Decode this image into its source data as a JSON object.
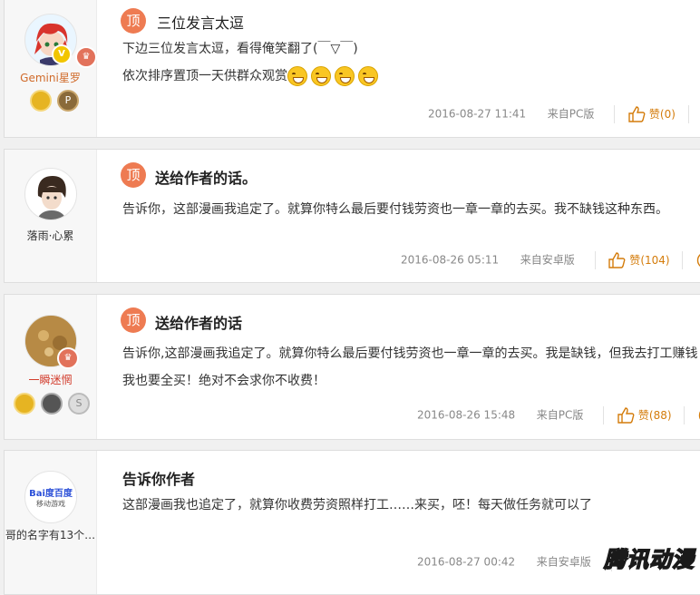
{
  "posts": [
    {
      "username": "Gemini星罗",
      "username_color": "#d06a2a",
      "pinned_label": "顶",
      "title": "三位发言太逗",
      "content_lines": [
        "下边三位发言太逗，看得俺笑翻了(￣▽￣)",
        "依次排序置顶一天供群众观赏"
      ],
      "date": "2016-08-27 11:41",
      "source": "来自PC版",
      "like_label": "赞",
      "like_count": "(0)",
      "vip_badge": "V",
      "emoji_count": 4
    },
    {
      "username": "落雨·心累",
      "username_color": "#333333",
      "pinned_label": "顶",
      "title": "送给作者的话。",
      "content_lines": [
        "告诉你，这部漫画我追定了。就算你特么最后要付钱劳资也一章一章的去买。我不缺钱这种东西。"
      ],
      "date": "2016-08-26 05:11",
      "source": "来自安卓版",
      "like_label": "赞",
      "like_count": "(104)"
    },
    {
      "username": "一瞬迷惘",
      "username_color": "#d23a2a",
      "pinned_label": "顶",
      "title": "送给作者的话",
      "content_lines": [
        "告诉你,这部漫画我追定了。就算你特么最后要付钱劳资也一章一章的去买。我是缺钱，但我去打工赚钱",
        "我也要全买！绝对不会求你不收费！"
      ],
      "date": "2016-08-26 15:48",
      "source": "来自PC版",
      "like_label": "赞",
      "like_count": "(88)"
    },
    {
      "username": "哥的名字有13个…",
      "username_color": "#333333",
      "title": "告诉你作者",
      "content_lines": [
        "这部漫画我也追定了，就算你收费劳资照样打工……来买，呸！每天做任务就可以了"
      ],
      "date": "2016-08-27 00:42",
      "source": "来自安卓版",
      "avatar_text": "Bai度百度",
      "avatar_subtext": "移动游戏"
    }
  ],
  "watermark": "腾讯动漫",
  "colors": {
    "pinned": "#ee7b52",
    "like": "#d47c0b",
    "meta": "#888888"
  },
  "icons": [
    "vip-badge-icon",
    "crown-icon",
    "medal-icon",
    "thumbs-up-icon",
    "comment-icon",
    "smiley-emoji-icon"
  ]
}
